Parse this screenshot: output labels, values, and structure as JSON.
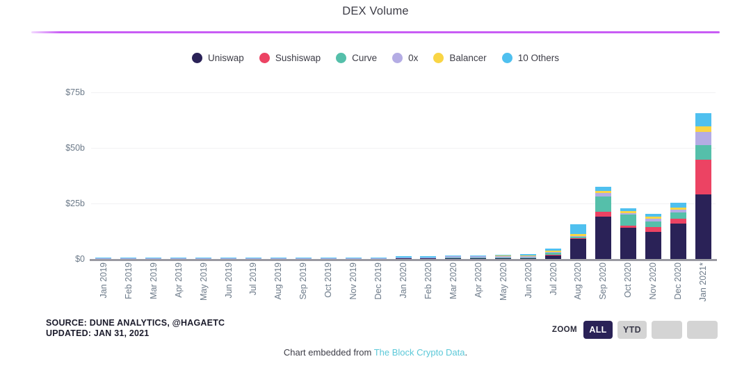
{
  "header": {
    "title": "DEX Volume"
  },
  "footer": {
    "source_line1": "SOURCE: DUNE ANALYTICS, @HAGAETC",
    "source_line2": "UPDATED: JAN 31, 2021",
    "embed_prefix": "Chart embedded from ",
    "embed_link": "The Block Crypto Data",
    "embed_suffix": "."
  },
  "zoom_controls": {
    "label": "ZOOM",
    "buttons": [
      {
        "label": "ALL",
        "active": true
      },
      {
        "label": "YTD",
        "active": false
      },
      {
        "label": "",
        "active": false
      },
      {
        "label": "",
        "active": false
      }
    ]
  },
  "colors": {
    "uniswap": "#2a2257",
    "sushiswap": "#ec4363",
    "curve": "#55bfaa",
    "zerox": "#b4ace4",
    "balancer": "#f9d545",
    "others": "#4fc0ef",
    "accent_rule": "#c85cf5",
    "link": "#5bc8d8",
    "axis": "#9a9aa2",
    "grid": "#f1f1f3",
    "tick_text": "#6c7a89"
  },
  "chart_data": {
    "type": "bar",
    "title": "DEX Volume",
    "stacked": true,
    "xlabel": "",
    "ylabel": "",
    "ylim": [
      0,
      78
    ],
    "yticks": [
      0,
      25,
      50,
      75
    ],
    "ytick_labels": [
      "$0",
      "$25b",
      "$50b",
      "$75b"
    ],
    "grid": true,
    "legend_position": "top-center",
    "units": "billions USD",
    "categories": [
      "Jan 2019",
      "Feb 2019",
      "Mar 2019",
      "Apr 2019",
      "May 2019",
      "Jun 2019",
      "Jul 2019",
      "Aug 2019",
      "Sep 2019",
      "Oct 2019",
      "Nov 2019",
      "Dec 2019",
      "Jan 2020",
      "Feb 2020",
      "Mar 2020",
      "Apr 2020",
      "May 2020",
      "Jun 2020",
      "Jul 2020",
      "Aug 2020",
      "Sep 2020",
      "Oct 2020",
      "Nov 2020",
      "Dec 2020",
      "Jan 2021*"
    ],
    "series": [
      {
        "name": "Uniswap",
        "color": "#2a2257",
        "values": [
          0.0,
          0.0,
          0.0,
          0.0,
          0.0,
          0.0,
          0.0,
          0.0,
          0.0,
          0.0,
          0.0,
          0.0,
          0.05,
          0.1,
          0.15,
          0.08,
          0.1,
          0.25,
          1.6,
          9.0,
          19.0,
          14.0,
          12.3,
          16.0,
          29.0
        ]
      },
      {
        "name": "Sushiswap",
        "color": "#ec4363",
        "values": [
          0,
          0,
          0,
          0,
          0,
          0,
          0,
          0,
          0,
          0,
          0,
          0,
          0,
          0,
          0,
          0,
          0,
          0,
          0.05,
          0.2,
          2.2,
          1.1,
          2.1,
          2.0,
          15.5
        ]
      },
      {
        "name": "Curve",
        "color": "#55bfaa",
        "values": [
          0,
          0,
          0,
          0,
          0,
          0,
          0,
          0,
          0,
          0,
          0,
          0,
          0,
          0,
          0.02,
          0.02,
          0.05,
          0.15,
          0.9,
          0.7,
          7.0,
          5.0,
          2.6,
          3.0,
          6.8
        ]
      },
      {
        "name": "0x",
        "color": "#b4ace4",
        "values": [
          0.02,
          0.02,
          0.02,
          0.02,
          0.02,
          0.03,
          0.03,
          0.03,
          0.03,
          0.03,
          0.03,
          0.03,
          0.05,
          0.08,
          0.1,
          0.05,
          0.06,
          0.1,
          0.25,
          0.2,
          1.3,
          0.6,
          1.2,
          1.1,
          5.8
        ]
      },
      {
        "name": "Balancer",
        "color": "#f9d545",
        "values": [
          0,
          0,
          0,
          0,
          0,
          0,
          0,
          0,
          0,
          0,
          0,
          0,
          0,
          0,
          0,
          0,
          0.02,
          0.15,
          0.5,
          0.7,
          1.0,
          0.7,
          0.7,
          0.9,
          2.6
        ]
      },
      {
        "name": "10 Others",
        "color": "#4fc0ef",
        "values": [
          0.05,
          0.05,
          0.05,
          0.05,
          0.05,
          0.08,
          0.08,
          0.08,
          0.08,
          0.08,
          0.08,
          0.08,
          0.3,
          0.5,
          0.6,
          0.3,
          0.35,
          0.6,
          1.1,
          4.5,
          1.9,
          1.5,
          1.5,
          2.2,
          5.8
        ]
      }
    ]
  }
}
